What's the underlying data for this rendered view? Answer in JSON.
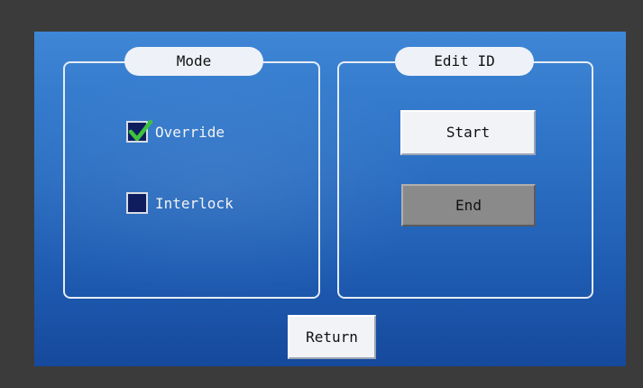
{
  "mode_panel": {
    "title": "Mode",
    "options": [
      {
        "label": "Override",
        "checked": true
      },
      {
        "label": "Interlock",
        "checked": false
      }
    ]
  },
  "edit_panel": {
    "title": "Edit ID",
    "start_label": "Start",
    "end_label": "End"
  },
  "return_label": "Return",
  "colors": {
    "check_mark": "#3ec23e",
    "checkbox_fill": "#0f1d5e",
    "end_button_bg": "#8a8a8a"
  }
}
